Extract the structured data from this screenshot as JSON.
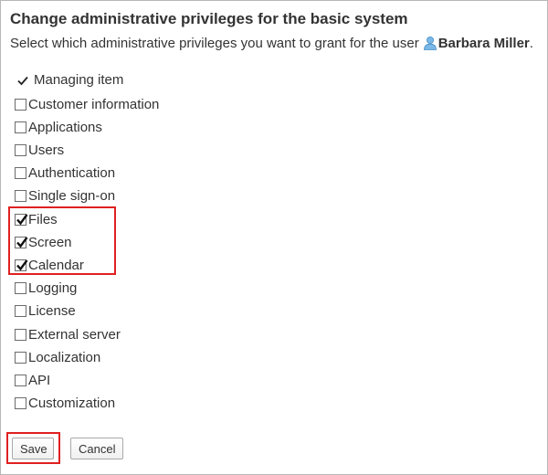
{
  "header": {
    "title": "Change administrative privileges for the basic system",
    "subtitle_prefix": "Select which administrative privileges you want to grant for the user",
    "username": "Barbara Miller",
    "subtitle_suffix": "."
  },
  "list": {
    "header_label": "Managing item",
    "items": [
      {
        "label": "Customer information",
        "checked": false
      },
      {
        "label": "Applications",
        "checked": false
      },
      {
        "label": "Users",
        "checked": false
      },
      {
        "label": "Authentication",
        "checked": false
      },
      {
        "label": "Single sign-on",
        "checked": false
      },
      {
        "label": "Files",
        "checked": true
      },
      {
        "label": "Screen",
        "checked": true
      },
      {
        "label": "Calendar",
        "checked": true
      },
      {
        "label": "Logging",
        "checked": false
      },
      {
        "label": "License",
        "checked": false
      },
      {
        "label": "External server",
        "checked": false
      },
      {
        "label": "Localization",
        "checked": false
      },
      {
        "label": "API",
        "checked": false
      },
      {
        "label": "Customization",
        "checked": false
      }
    ]
  },
  "buttons": {
    "save_label": "Save",
    "cancel_label": "Cancel"
  },
  "colors": {
    "highlight": "#e02020",
    "user_icon": "#7ab8e8"
  }
}
